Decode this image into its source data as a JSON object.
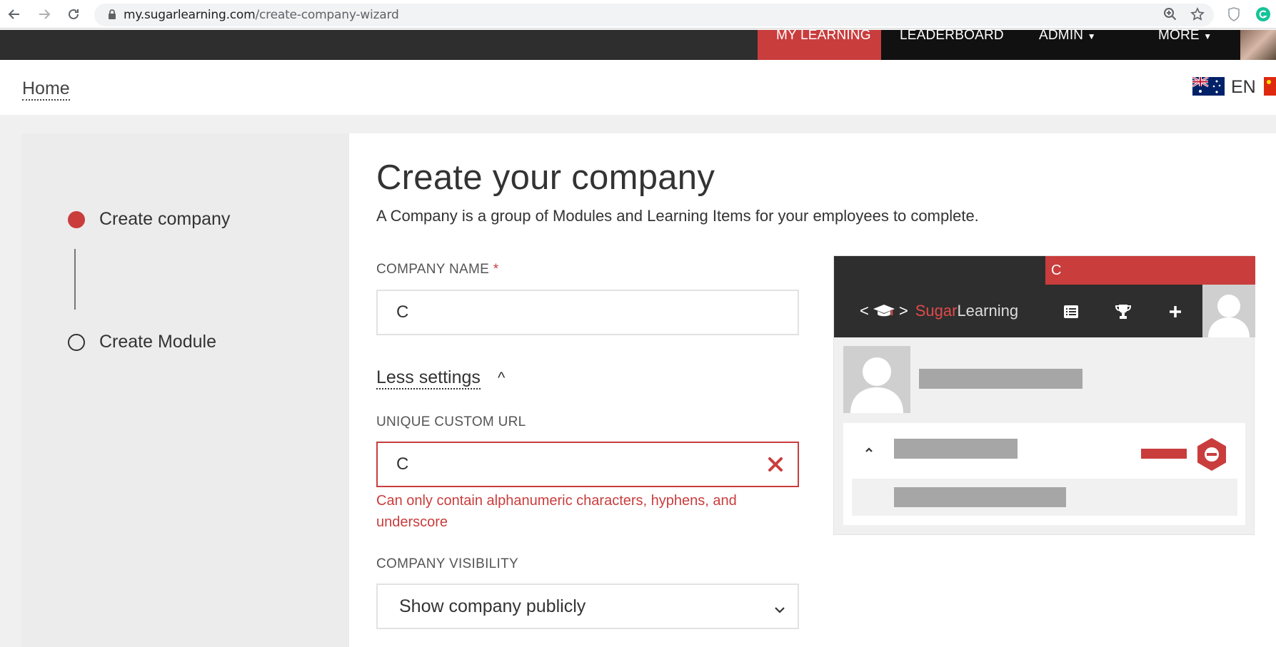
{
  "browser": {
    "url_domain": "my.sugarlearning.com",
    "url_path": "/create-company-wizard"
  },
  "site_nav": {
    "items": [
      {
        "label": "MY LEARNING",
        "active": true
      },
      {
        "label": "LEADERBOARD",
        "active": false
      },
      {
        "label": "ADMIN",
        "active": false
      },
      {
        "label": "MORE",
        "active": false
      }
    ]
  },
  "home_bar": {
    "home_label": "Home",
    "language": "EN"
  },
  "wizard_steps": [
    {
      "label": "Create company",
      "state": "current"
    },
    {
      "label": "Create Module",
      "state": "pending"
    }
  ],
  "form": {
    "title": "Create your company",
    "subtitle": "A Company is a group of Modules and Learning Items for your employees to complete.",
    "company_name_label": "COMPANY NAME",
    "required_mark": "*",
    "company_name_value": "C",
    "less_settings_label": "Less settings",
    "less_settings_caret": "^",
    "custom_url_label": "UNIQUE CUSTOM URL",
    "custom_url_value": "C",
    "custom_url_error": "Can only contain alphanumeric characters, hyphens, and underscore",
    "visibility_label": "COMPANY VISIBILITY",
    "visibility_value": "Show company publicly"
  },
  "preview": {
    "company_initial": "C",
    "logo_brackets_left": "<",
    "logo_brackets_right": ">",
    "logo_sugar": "Sugar",
    "logo_learning": "Learning"
  },
  "colors": {
    "accent_red": "#c93d3d",
    "nav_dark": "#2e2e2e"
  }
}
